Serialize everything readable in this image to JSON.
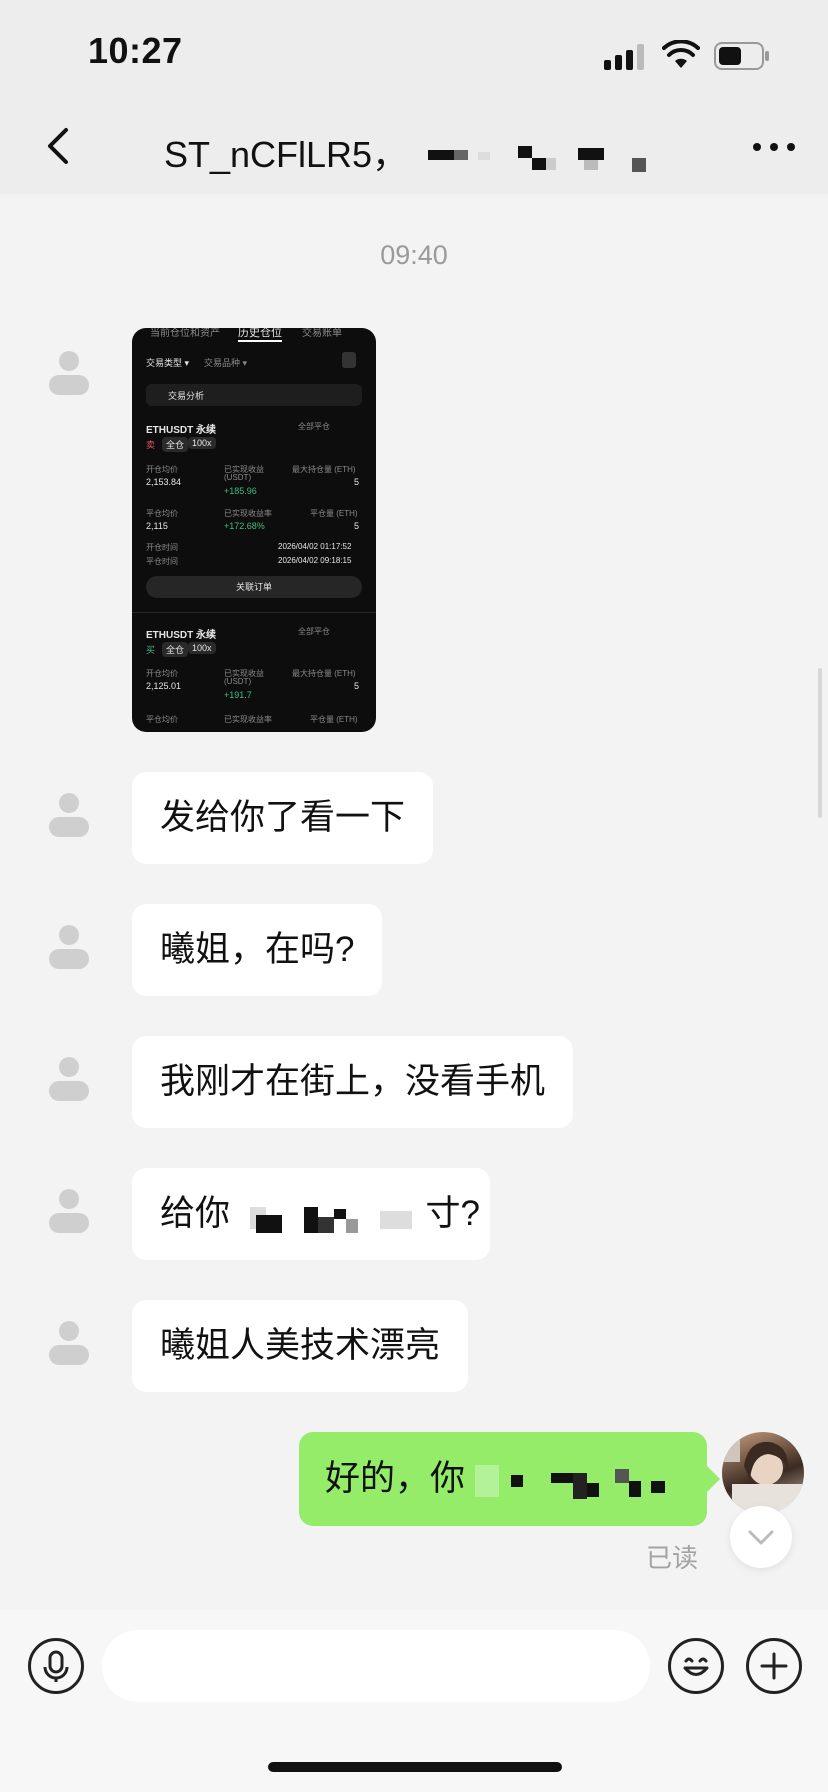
{
  "status_bar": {
    "time": "10:27",
    "battery_level": 0.5
  },
  "header": {
    "title": "ST_nCFlLR5，"
  },
  "chat": {
    "timestamp": "09:40",
    "screenshot": {
      "tabs": [
        "当前仓位和资产",
        "历史仓位",
        "交易账单"
      ],
      "filter_trade_type": "交易类型 ▾",
      "filter_asset": "交易品种 ▾",
      "analysis_label": "交易分析",
      "positions": [
        {
          "symbol": "ETHUSDT 永续",
          "side": "卖",
          "margin": "全仓",
          "leverage": "100x",
          "share": "全部平仓",
          "open_avg_label": "开仓均价",
          "open_avg": "2,153.84",
          "realized_label": "已实现收益",
          "realized_unit": "(USDT)",
          "realized": "+185.96",
          "max_hold_label": "最大持仓量 (ETH)",
          "max_hold": "5",
          "close_avg_label": "平仓均价",
          "close_avg": "2,115",
          "rate_label": "已实现收益率",
          "rate": "+172.68%",
          "close_qty_label": "平仓量 (ETH)",
          "close_qty": "5",
          "open_time_label": "开仓时间",
          "open_time": "2026/04/02 01:17:52",
          "close_time_label": "平仓时间",
          "close_time": "2026/04/02 09:18:15",
          "order_button": "关联订单"
        },
        {
          "symbol": "ETHUSDT 永续",
          "side": "买",
          "margin": "全仓",
          "leverage": "100x",
          "share": "全部平仓",
          "open_avg_label": "开仓均价",
          "open_avg": "2,125.01",
          "realized_label": "已实现收益",
          "realized_unit": "(USDT)",
          "realized": "+191.7",
          "max_hold_label": "最大持仓量 (ETH)",
          "max_hold": "5",
          "close_avg_label": "平仓均价",
          "rate_label": "已实现收益率",
          "close_qty_label": "平仓量 (ETH)"
        }
      ]
    },
    "incoming": [
      "发给你了看一下",
      "曦姐，在吗?",
      "我刚才在街上，没看手机",
      "给你",
      "曦姐人美技术漂亮"
    ],
    "incoming_4_tail": "寸?",
    "outgoing": {
      "text": "好的，你",
      "read_status": "已读"
    }
  },
  "input_bar": {
    "placeholder": ""
  },
  "colors": {
    "outgoing_bubble": "#95ec69",
    "chat_bg": "#f3f3f3",
    "incoming_bubble": "#ffffff"
  }
}
